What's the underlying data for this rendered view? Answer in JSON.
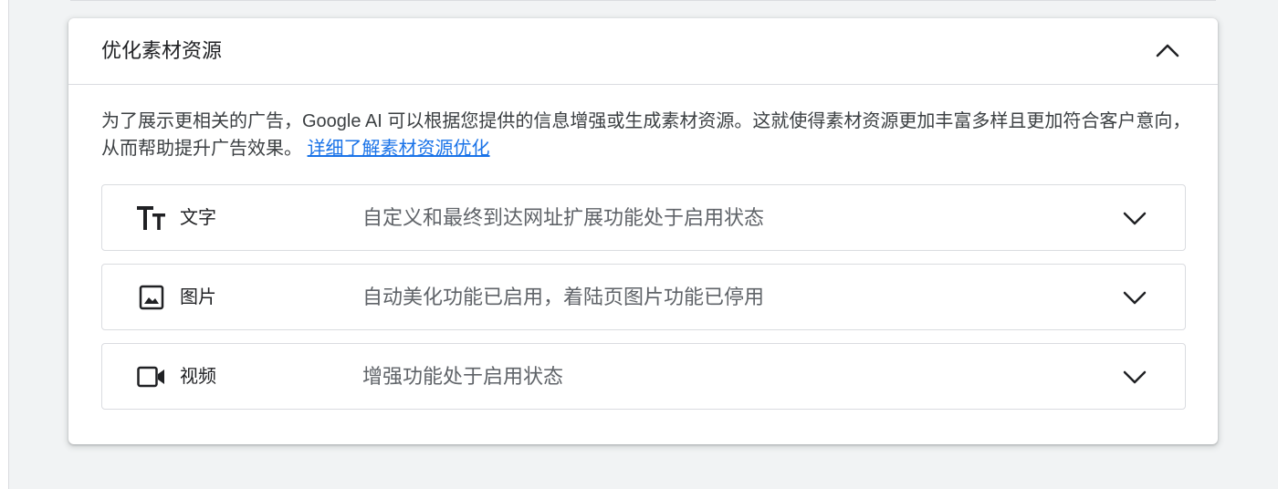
{
  "panel": {
    "title": "优化素材资源",
    "collapse_icon": "chevron-up-icon",
    "description_text": "为了展示更相关的广告，Google AI 可以根据您提供的信息增强或生成素材资源。这就使得素材资源更加丰富多样且更加符合客户意向，从而帮助提升广告效果。",
    "learn_more_link": "详细了解素材资源优化"
  },
  "rows": [
    {
      "icon": "text-format-icon",
      "label": "文字",
      "status": "自定义和最终到达网址扩展功能处于启用状态",
      "chevron": "chevron-down-icon"
    },
    {
      "icon": "image-icon",
      "label": "图片",
      "status": "自动美化功能已启用，着陆页图片功能已停用",
      "chevron": "chevron-down-icon"
    },
    {
      "icon": "video-icon",
      "label": "视频",
      "status": "增强功能处于启用状态",
      "chevron": "chevron-down-icon"
    }
  ],
  "colors": {
    "link": "#1a73e8",
    "border": "#dadce0",
    "background": "#f1f3f4",
    "icon": "#202124",
    "status_text": "#5f6368"
  }
}
